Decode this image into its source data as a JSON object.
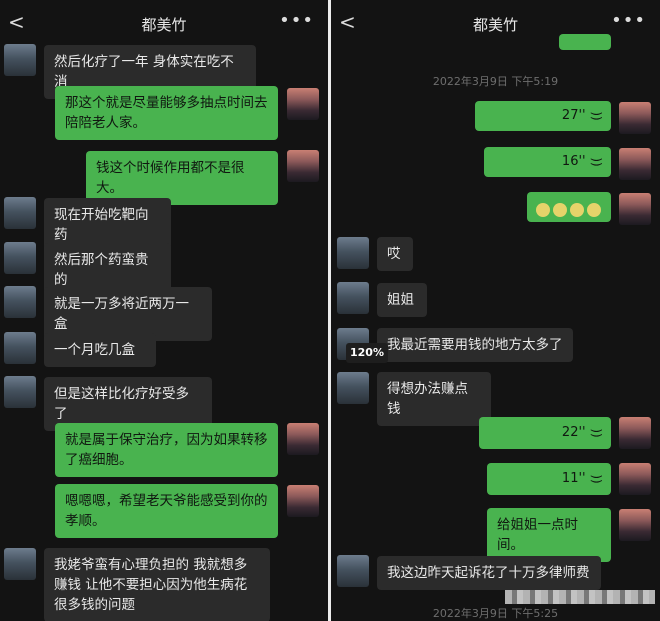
{
  "left": {
    "header": {
      "title": "都美竹",
      "back": "<",
      "more": "•••"
    },
    "messages": [
      "然后化疗了一年 身体实在吃不消",
      "那这个就是尽量能够多抽点时间去陪陪老人家。",
      "钱这个时候作用都不是很大。",
      "现在开始吃靶向药",
      "然后那个药蛮贵的",
      "就是一万多将近两万一盒",
      "一个月吃几盒",
      "但是这样比化疗好受多了",
      "就是属于保守治疗，因为如果转移了癌细胞。",
      "嗯嗯嗯，希望老天爷能感受到你的孝顺。",
      "我姥爷蛮有心理负担的 我就想多赚钱 让他不要担心因为他生病花很多钱的问题"
    ]
  },
  "right": {
    "header": {
      "title": "都美竹",
      "back": "<",
      "more": "•••"
    },
    "timestamp_top": "2022年3月9日 下午5:19",
    "timestamp_bottom": "2022年3月9日 下午5:25",
    "voice": [
      "27''",
      "16''",
      "22''",
      "11''"
    ],
    "messages": [
      "哎",
      "姐姐",
      "我最近需要用钱的地方太多了",
      "得想办法赚点钱",
      "给姐姐一点时间。",
      "我这边昨天起诉花了十万多律师费"
    ]
  },
  "zoom": "120%",
  "colors": {
    "bg": "#131313",
    "green": "#49b34f",
    "gray_bubble": "#2b2b2b"
  }
}
